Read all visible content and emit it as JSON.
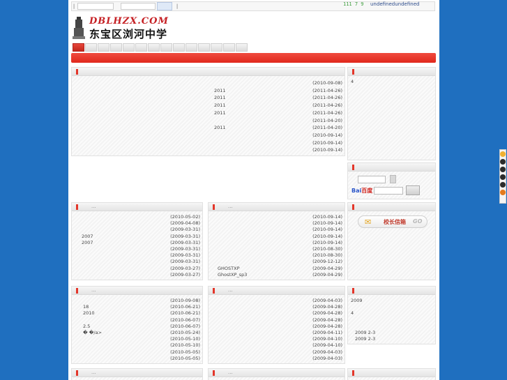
{
  "topbar": {
    "sep1": "|",
    "sep2": "|",
    "number": "111 7 9",
    "undef": "undefinedundefined"
  },
  "logo": {
    "domain": "DBLHZX.COM",
    "name": "东宝区浏河中学"
  },
  "main": {
    "rows": [
      {
        "text": "",
        "date": "(2010-09-08)"
      },
      {
        "text": "2011",
        "date": "(2011-04-26)"
      },
      {
        "text": "2011",
        "date": "(2011-04-26)"
      },
      {
        "text": "2011",
        "date": "(2011-04-26)"
      },
      {
        "text": "2011",
        "date": "(2011-04-26)"
      },
      {
        "text": "",
        "date": "(2011-04-20)"
      },
      {
        "text": "2011",
        "date": "(2011-04-20)"
      },
      {
        "text": "",
        "date": "(2010-09-14)"
      },
      {
        "text": "",
        "date": "(2010-09-14)"
      },
      {
        "text": "",
        "date": "(2010-09-14)"
      }
    ]
  },
  "side1": {
    "value": "4"
  },
  "side2": {
    "baidu_prefix": "Bai",
    "baidu_suffix": "百度"
  },
  "side3": {
    "mail_label": "校长信箱",
    "go": "GO"
  },
  "p1": {
    "title": "...",
    "rows": [
      {
        "text": "",
        "date": "(2010-05-02)"
      },
      {
        "text": "",
        "date": "(2009-04-08)"
      },
      {
        "text": "",
        "date": "(2009-03-31)"
      },
      {
        "text": "2007",
        "date": "(2009-03-31)"
      },
      {
        "text": "2007",
        "date": "(2009-03-31)"
      },
      {
        "text": "",
        "date": "(2009-03-31)"
      },
      {
        "text": "",
        "date": "(2009-03-31)"
      },
      {
        "text": "",
        "date": "(2009-03-31)"
      },
      {
        "text": "",
        "date": "(2009-03-27)"
      },
      {
        "text": "",
        "date": "(2009-03-27)"
      }
    ]
  },
  "p2": {
    "title": "...",
    "rows": [
      {
        "text": "",
        "date": "(2010-09-14)"
      },
      {
        "text": "",
        "date": "(2010-09-14)"
      },
      {
        "text": "",
        "date": "(2010-09-14)"
      },
      {
        "text": "",
        "date": "(2010-09-14)"
      },
      {
        "text": "",
        "date": "(2010-09-14)"
      },
      {
        "text": "",
        "date": "(2010-08-30)"
      },
      {
        "text": "",
        "date": "(2010-08-30)"
      },
      {
        "text": "",
        "date": "(2009-12-12)"
      },
      {
        "text": "GHOSTXP",
        "date": "(2009-04-29)"
      },
      {
        "text": "GhostXP_sp3",
        "date": "(2009-04-29)"
      }
    ]
  },
  "p4": {
    "title": "...",
    "rows": [
      {
        "text": "",
        "date": "(2010-09-08)"
      },
      {
        "text": "18",
        "date": "(2010-06-21)"
      },
      {
        "text": "2010",
        "date": "(2010-06-21)"
      },
      {
        "text": "",
        "date": "(2010-06-07)"
      },
      {
        "text": "2.5",
        "date": "(2010-06-07)"
      },
      {
        "text": "�      �/a>",
        "date": "(2010-05-24)"
      },
      {
        "text": "",
        "date": "(2010-05-10)"
      },
      {
        "text": "",
        "date": "(2010-05-10)"
      },
      {
        "text": "",
        "date": "(2010-05-05)"
      },
      {
        "text": "",
        "date": "(2010-05-05)"
      }
    ]
  },
  "p5": {
    "title": "...",
    "rows": [
      {
        "text": "",
        "date": "(2009-04-03)"
      },
      {
        "text": "",
        "date": "(2009-04-28)"
      },
      {
        "text": "",
        "date": "(2009-04-28)"
      },
      {
        "text": "",
        "date": "(2009-04-28)"
      },
      {
        "text": "",
        "date": "(2009-04-28)"
      },
      {
        "text": "",
        "date": "(2009-04-11)"
      },
      {
        "text": "",
        "date": "(2009-04-10)"
      },
      {
        "text": "",
        "date": "(2009-04-10)"
      },
      {
        "text": "",
        "date": "(2009-04-03)"
      },
      {
        "text": "",
        "date": "(2009-04-03)"
      }
    ]
  },
  "p6": {
    "lines": [
      "2009",
      "",
      "4",
      "",
      "",
      "2009 2-3",
      "2009 2-3"
    ]
  },
  "bottom": {
    "t1": "...",
    "t2": "..."
  },
  "colors": {
    "accent": "#e0281c",
    "background": "#1f6fbf"
  }
}
